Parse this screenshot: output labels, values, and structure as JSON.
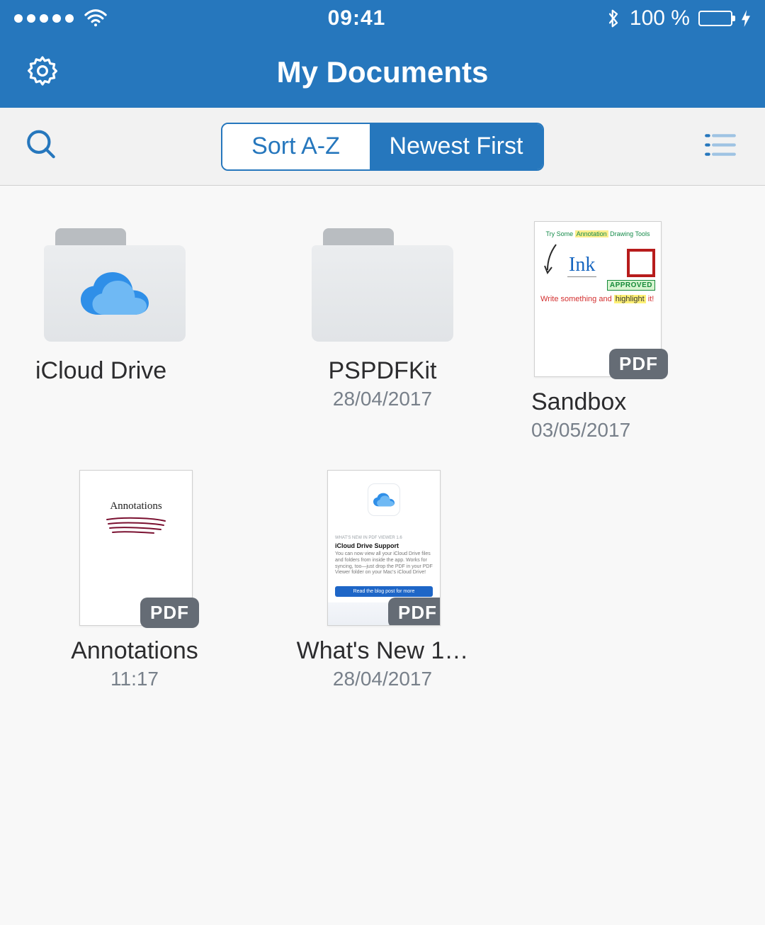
{
  "statusbar": {
    "time": "09:41",
    "battery_text": "100 %"
  },
  "nav": {
    "title": "My Documents"
  },
  "toolbar": {
    "segments": {
      "sort_az": "Sort A-Z",
      "newest_first": "Newest First"
    }
  },
  "items": [
    {
      "title": "iCloud Drive",
      "subtitle": ""
    },
    {
      "title": "PSPDFKit",
      "subtitle": "28/04/2017"
    },
    {
      "title": "Sandbox",
      "subtitle": "03/05/2017"
    },
    {
      "title": "Annotations",
      "subtitle": "11:17"
    },
    {
      "title": "What's New 1…",
      "subtitle": "28/04/2017"
    }
  ],
  "badges": {
    "pdf": "PDF"
  },
  "thumb": {
    "sandbox": {
      "header_pre": "Try Some ",
      "header_hl": "Annotation",
      "header_post": " Drawing Tools",
      "ink": "Ink",
      "approved": "APPROVED",
      "write_pre": "Write something and ",
      "write_hl": "highlight",
      "write_post": " it!"
    },
    "annotations": {
      "label": "Annotations"
    },
    "whatsnew": {
      "kicker": "WHAT'S NEW IN PDF VIEWER 1.6",
      "title": "iCloud Drive Support",
      "body": "You can now view all your iCloud Drive files and folders from inside the app. Works for syncing, too—just drop the PDF in your PDF Viewer folder on your Mac's iCloud Drive!",
      "button": "Read the blog post for more"
    }
  }
}
